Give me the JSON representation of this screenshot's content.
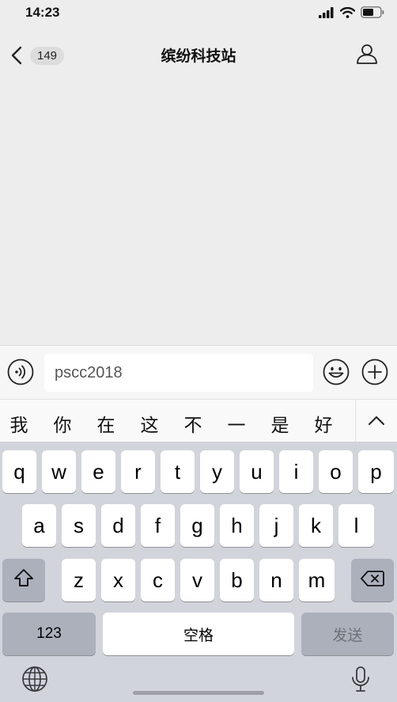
{
  "status_bar": {
    "time": "14:23"
  },
  "nav": {
    "unread_count": "149",
    "title": "缤纷科技站"
  },
  "input": {
    "value": "pscc2018"
  },
  "candidates": [
    "我",
    "你",
    "在",
    "这",
    "不",
    "一",
    "是",
    "好"
  ],
  "keyboard": {
    "row1": [
      "q",
      "w",
      "e",
      "r",
      "t",
      "y",
      "u",
      "i",
      "o",
      "p"
    ],
    "row2": [
      "a",
      "s",
      "d",
      "f",
      "g",
      "h",
      "j",
      "k",
      "l"
    ],
    "row3": [
      "z",
      "x",
      "c",
      "v",
      "b",
      "n",
      "m"
    ],
    "numbers_label": "123",
    "space_label": "空格",
    "send_label": "发送"
  },
  "icons": {
    "status": [
      "signal-icon",
      "wifi-icon",
      "battery-icon"
    ],
    "nav": [
      "chevron-left-icon",
      "person-icon"
    ],
    "input": [
      "voice-icon",
      "emoji-icon",
      "plus-icon"
    ],
    "keyboard": [
      "shift-icon",
      "backspace-icon",
      "globe-icon",
      "microphone-icon",
      "chevron-up-icon"
    ]
  }
}
